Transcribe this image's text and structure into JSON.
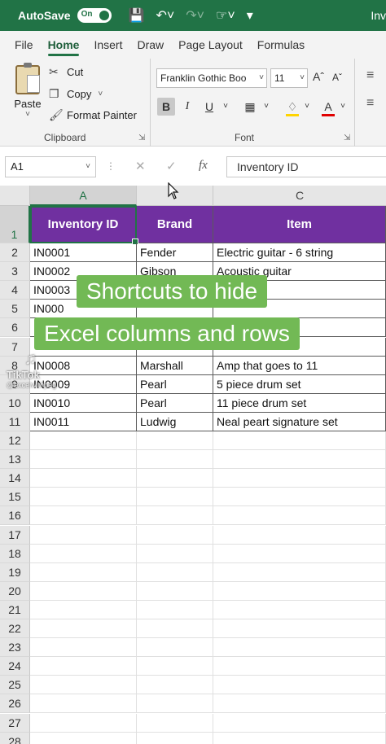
{
  "titlebar": {
    "autosave_label": "AutoSave",
    "toggle_label": "On",
    "title": "Inv"
  },
  "tabs": [
    {
      "label": "File"
    },
    {
      "label": "Home"
    },
    {
      "label": "Insert"
    },
    {
      "label": "Draw"
    },
    {
      "label": "Page Layout"
    },
    {
      "label": "Formulas"
    }
  ],
  "clipboard": {
    "paste_label": "Paste",
    "cut_label": "Cut",
    "copy_label": "Copy",
    "format_painter_label": "Format Painter",
    "group_label": "Clipboard"
  },
  "font": {
    "name": "Franklin Gothic Boo",
    "size": "11",
    "bold": "B",
    "italic": "I",
    "underline": "U",
    "group_label": "Font",
    "fill_color": "#ffd400",
    "font_color": "#e00000"
  },
  "formula_bar": {
    "name_box": "A1",
    "fx": "fx",
    "value": "Inventory ID"
  },
  "grid": {
    "columns": [
      "A",
      "B",
      "C"
    ],
    "headers": [
      "Inventory ID",
      "Brand",
      "Item"
    ],
    "rows": [
      {
        "num": "2",
        "cells": [
          "IN0001",
          "Fender",
          "Electric guitar - 6 string"
        ]
      },
      {
        "num": "3",
        "cells": [
          "IN0002",
          "Gibson",
          "Acoustic guitar"
        ]
      },
      {
        "num": "4",
        "cells": [
          "IN0003",
          "",
          "2 string"
        ]
      },
      {
        "num": "5",
        "cells": [
          "IN000",
          "",
          ""
        ]
      },
      {
        "num": "6",
        "cells": [
          "",
          "",
          ""
        ]
      },
      {
        "num": "7",
        "cells": [
          "",
          "",
          ""
        ]
      },
      {
        "num": "8",
        "cells": [
          "IN0008",
          "Marshall",
          "Amp that goes to 11"
        ]
      },
      {
        "num": "9",
        "cells": [
          "IN0009",
          "Pearl",
          "5 piece drum set"
        ]
      },
      {
        "num": "10",
        "cells": [
          "IN0010",
          "Pearl",
          "11 piece drum set"
        ]
      },
      {
        "num": "11",
        "cells": [
          "IN0011",
          "Ludwig",
          "Neal peart signature set"
        ]
      }
    ],
    "empty_rows": [
      "12",
      "13",
      "14",
      "15",
      "16",
      "17",
      "18",
      "19",
      "20",
      "21",
      "22",
      "23",
      "24",
      "25",
      "26",
      "27",
      "28"
    ],
    "header_row_num": "1",
    "header_color": "#7030a0"
  },
  "overlay": {
    "line1": "Shortcuts to hide",
    "line2": "Excel columns and rows",
    "color": "#72b955"
  },
  "watermark": {
    "brand": "TikTok",
    "handle": "@excelwithpeg"
  },
  "colors": {
    "excel_green": "#217346"
  }
}
